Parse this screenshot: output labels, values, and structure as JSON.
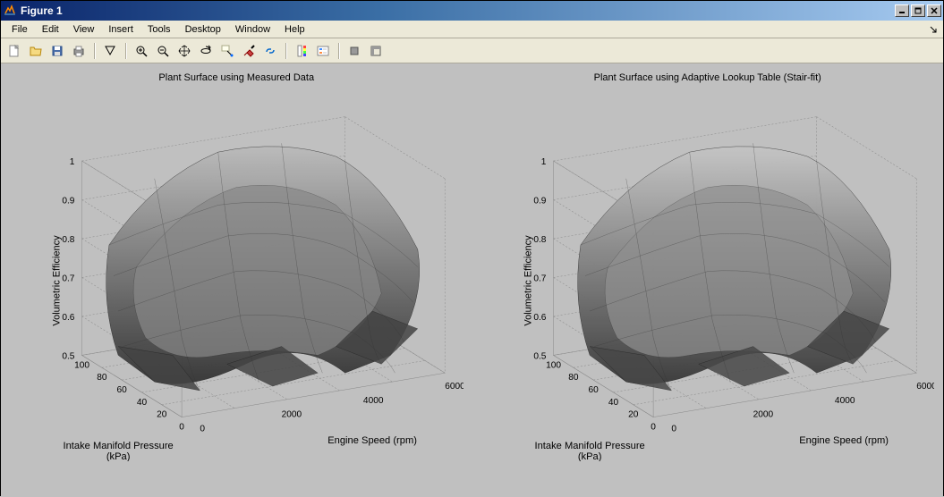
{
  "window": {
    "title": "Figure 1"
  },
  "menubar": {
    "items": [
      "File",
      "Edit",
      "View",
      "Insert",
      "Tools",
      "Desktop",
      "Window",
      "Help"
    ]
  },
  "toolbar": {
    "groups": [
      [
        "new-figure",
        "open-file",
        "save-figure",
        "print-figure"
      ],
      [
        "edit-plot"
      ],
      [
        "zoom-in",
        "zoom-out",
        "pan",
        "rotate-3d",
        "data-cursor",
        "brush",
        "link-plot"
      ],
      [
        "insert-colorbar",
        "insert-legend"
      ],
      [
        "hide-plot-tools",
        "show-plot-tools"
      ]
    ]
  },
  "charts": [
    {
      "title": "Plant Surface using Measured Data",
      "zlabel": "Volumetric Efficiency",
      "xlabel": "Intake Manifold Pressure\n(kPa)",
      "ylabel": "Engine Speed (rpm)",
      "xticks": [
        "0",
        "20",
        "40",
        "60",
        "80",
        "100"
      ],
      "yticks": [
        "0",
        "2000",
        "4000",
        "6000"
      ],
      "zticks": [
        "0.5",
        "0.6",
        "0.7",
        "0.8",
        "0.9",
        "1"
      ]
    },
    {
      "title": "Plant Surface using Adaptive Lookup Table (Stair-fit)",
      "zlabel": "Volumetric Efficiency",
      "xlabel": "Intake Manifold Pressure\n(kPa)",
      "ylabel": "Engine Speed (rpm)",
      "xticks": [
        "0",
        "20",
        "40",
        "60",
        "80",
        "100"
      ],
      "yticks": [
        "0",
        "2000",
        "4000",
        "6000"
      ],
      "zticks": [
        "0.5",
        "0.6",
        "0.7",
        "0.8",
        "0.9",
        "1"
      ]
    }
  ],
  "chart_data": [
    {
      "type": "surface",
      "title": "Plant Surface using Measured Data",
      "xlabel": "Engine Speed (rpm)",
      "ylabel": "Intake Manifold Pressure (kPa)",
      "zlabel": "Volumetric Efficiency",
      "x": [
        0,
        1000,
        2000,
        3000,
        4000,
        5000,
        6000
      ],
      "y": [
        0,
        20,
        40,
        60,
        80,
        100
      ],
      "z": [
        [
          0.55,
          0.6,
          0.58,
          0.55,
          0.52,
          0.5,
          0.5
        ],
        [
          0.7,
          0.78,
          0.8,
          0.75,
          0.68,
          0.6,
          0.55
        ],
        [
          0.78,
          0.88,
          0.92,
          0.9,
          0.82,
          0.72,
          0.62
        ],
        [
          0.8,
          0.92,
          0.97,
          0.98,
          0.92,
          0.82,
          0.7
        ],
        [
          0.8,
          0.92,
          0.98,
          1.0,
          0.96,
          0.88,
          0.76
        ],
        [
          0.8,
          0.9,
          0.96,
          0.98,
          0.96,
          0.9,
          0.8
        ]
      ],
      "xlim": [
        0,
        6000
      ],
      "ylim": [
        0,
        100
      ],
      "zlim": [
        0.5,
        1.0
      ],
      "grid": true,
      "colormap": "gray"
    },
    {
      "type": "surface",
      "title": "Plant Surface using Adaptive Lookup Table (Stair-fit)",
      "xlabel": "Engine Speed (rpm)",
      "ylabel": "Intake Manifold Pressure (kPa)",
      "zlabel": "Volumetric Efficiency",
      "x": [
        0,
        1000,
        2000,
        3000,
        4000,
        5000,
        6000
      ],
      "y": [
        0,
        20,
        40,
        60,
        80,
        100
      ],
      "z": [
        [
          0.55,
          0.6,
          0.58,
          0.55,
          0.52,
          0.5,
          0.5
        ],
        [
          0.7,
          0.78,
          0.8,
          0.75,
          0.68,
          0.6,
          0.55
        ],
        [
          0.78,
          0.88,
          0.92,
          0.9,
          0.82,
          0.72,
          0.62
        ],
        [
          0.8,
          0.92,
          0.97,
          0.98,
          0.92,
          0.82,
          0.7
        ],
        [
          0.8,
          0.92,
          0.98,
          1.0,
          0.96,
          0.88,
          0.76
        ],
        [
          0.8,
          0.9,
          0.96,
          0.98,
          0.96,
          0.9,
          0.8
        ]
      ],
      "xlim": [
        0,
        6000
      ],
      "ylim": [
        0,
        100
      ],
      "zlim": [
        0.5,
        1.0
      ],
      "grid": true,
      "colormap": "gray"
    }
  ]
}
